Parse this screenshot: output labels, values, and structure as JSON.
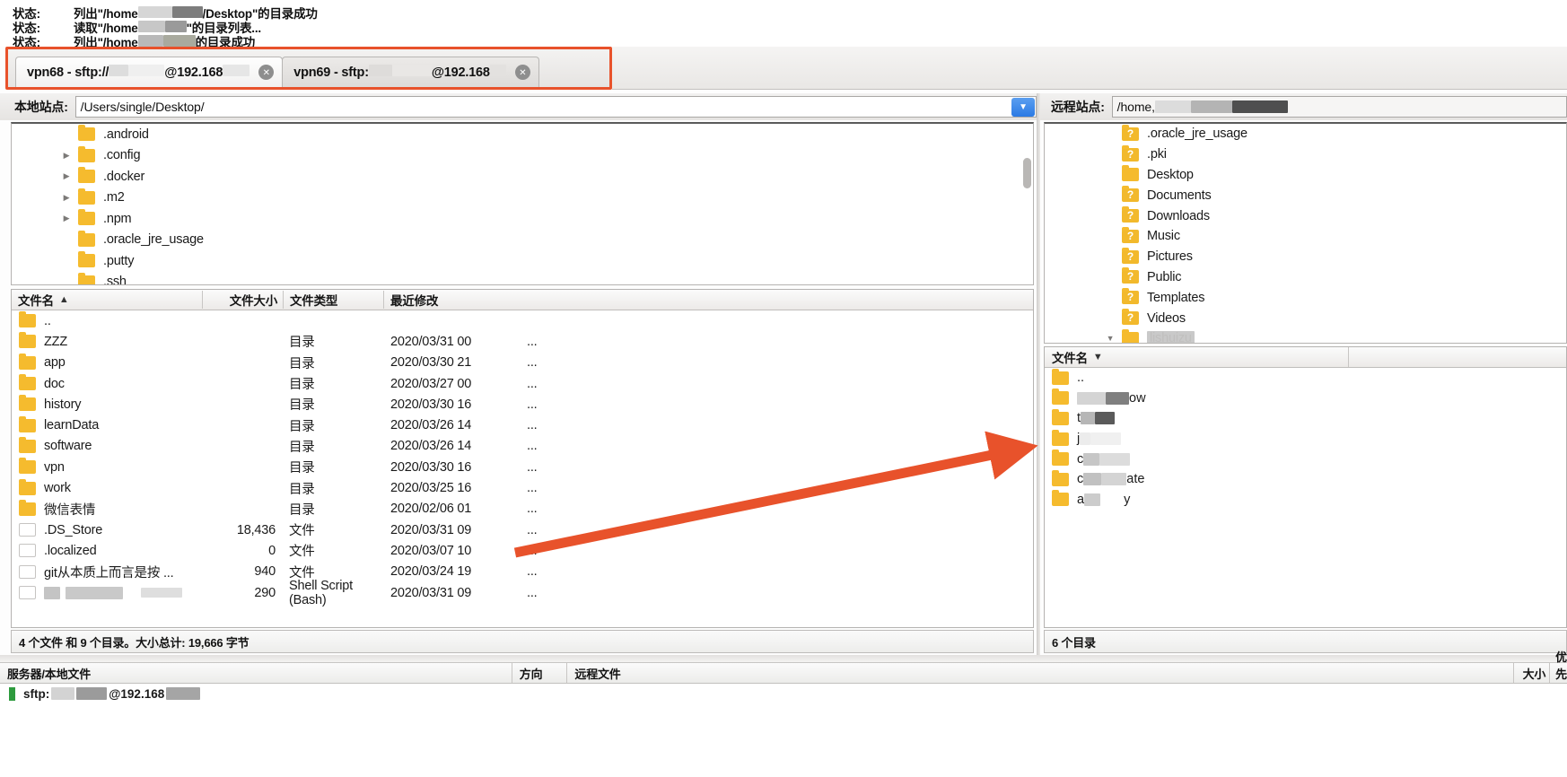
{
  "message_log": {
    "label": "状态:",
    "rows": [
      {
        "prefix": "列出\"/home",
        "suffix": "/Desktop\"的目录成功"
      },
      {
        "prefix": "读取\"/home",
        "suffix": "\"的目录列表..."
      },
      {
        "prefix": "列出\"/home",
        "suffix": "的目录成功"
      }
    ]
  },
  "tabs": {
    "highlighted": true,
    "highlight_color": "#e8522b",
    "items": [
      {
        "title_start": "vpn68 - sftp://",
        "title_mid": "@192.168",
        "title_end": "",
        "active": true,
        "close_label": "✕"
      },
      {
        "title_start": "vpn69 - sftp:",
        "title_mid": "@192.168",
        "title_end": "",
        "active": false,
        "close_label": "✕"
      }
    ]
  },
  "local": {
    "site_label": "本地站点:",
    "site_path": "/Users/single/Desktop/",
    "dropdown_icon": "chevron-down-icon",
    "tree": [
      {
        "name": ".android",
        "expandable": false
      },
      {
        "name": ".config",
        "expandable": true
      },
      {
        "name": ".docker",
        "expandable": true
      },
      {
        "name": ".m2",
        "expandable": true
      },
      {
        "name": ".npm",
        "expandable": true
      },
      {
        "name": ".oracle_jre_usage",
        "expandable": false
      },
      {
        "name": ".putty",
        "expandable": false
      },
      {
        "name": ".ssh",
        "expandable": false
      }
    ],
    "columns": [
      "文件名",
      "文件大小",
      "文件类型",
      "最近修改"
    ],
    "sort_indicator": "▲",
    "files": [
      {
        "name": "..",
        "size": "",
        "type": "",
        "modified": "",
        "ell": "",
        "icon": "folder"
      },
      {
        "name": "ZZZ",
        "size": "",
        "type": "目录",
        "modified": "2020/03/31 00",
        "ell": "...",
        "icon": "folder"
      },
      {
        "name": "app",
        "size": "",
        "type": "目录",
        "modified": "2020/03/30 21",
        "ell": "...",
        "icon": "folder"
      },
      {
        "name": "doc",
        "size": "",
        "type": "目录",
        "modified": "2020/03/27 00",
        "ell": "...",
        "icon": "folder"
      },
      {
        "name": "history",
        "size": "",
        "type": "目录",
        "modified": "2020/03/30 16",
        "ell": "...",
        "icon": "folder"
      },
      {
        "name": "learnData",
        "size": "",
        "type": "目录",
        "modified": "2020/03/26 14",
        "ell": "...",
        "icon": "folder"
      },
      {
        "name": "software",
        "size": "",
        "type": "目录",
        "modified": "2020/03/26 14",
        "ell": "...",
        "icon": "folder"
      },
      {
        "name": "vpn",
        "size": "",
        "type": "目录",
        "modified": "2020/03/30 16",
        "ell": "...",
        "icon": "folder"
      },
      {
        "name": "work",
        "size": "",
        "type": "目录",
        "modified": "2020/03/25 16",
        "ell": "...",
        "icon": "folder"
      },
      {
        "name": "微信表情",
        "size": "",
        "type": "目录",
        "modified": "2020/02/06 01",
        "ell": "...",
        "icon": "folder"
      },
      {
        "name": ".DS_Store",
        "size": "18,436",
        "type": "文件",
        "modified": "2020/03/31 09",
        "ell": "...",
        "icon": "file"
      },
      {
        "name": ".localized",
        "size": "0",
        "type": "文件",
        "modified": "2020/03/07 10",
        "ell": "...",
        "icon": "file"
      },
      {
        "name": "git从本质上而言是按 ...",
        "size": "940",
        "type": "文件",
        "modified": "2020/03/24 19",
        "ell": "...",
        "icon": "file"
      },
      {
        "name": "",
        "size": "290",
        "type": "Shell Script (Bash)",
        "modified": "2020/03/31 09",
        "ell": "...",
        "icon": "file",
        "redacted": true
      }
    ],
    "status": "4 个文件 和 9 个目录。大小总计: 19,666 字节"
  },
  "remote": {
    "site_label": "远程站点:",
    "site_path": "/home,",
    "tree": [
      {
        "name": ".oracle_jre_usage",
        "icon": "question-folder",
        "expandable": false,
        "selected": false
      },
      {
        "name": ".pki",
        "icon": "question-folder",
        "expandable": false,
        "selected": false
      },
      {
        "name": "Desktop",
        "icon": "folder",
        "expandable": false,
        "selected": false
      },
      {
        "name": "Documents",
        "icon": "question-folder",
        "expandable": false,
        "selected": false
      },
      {
        "name": "Downloads",
        "icon": "question-folder",
        "expandable": false,
        "selected": false
      },
      {
        "name": "Music",
        "icon": "question-folder",
        "expandable": false,
        "selected": false
      },
      {
        "name": "Pictures",
        "icon": "question-folder",
        "expandable": false,
        "selected": false
      },
      {
        "name": "Public",
        "icon": "question-folder",
        "expandable": false,
        "selected": false
      },
      {
        "name": "Templates",
        "icon": "question-folder",
        "expandable": false,
        "selected": false
      },
      {
        "name": "Videos",
        "icon": "question-folder",
        "expandable": false,
        "selected": false
      },
      {
        "name": "lishuizu",
        "icon": "folder",
        "expandable": true,
        "selected": true
      }
    ],
    "columns": [
      "文件名"
    ],
    "sort_indicator": "▼",
    "files": [
      {
        "name": "..",
        "redacted": false,
        "tail": ""
      },
      {
        "name": "",
        "redacted": true,
        "tail": "ow"
      },
      {
        "name": "t",
        "redacted": true,
        "tail": ""
      },
      {
        "name": "j",
        "redacted": true,
        "tail": ""
      },
      {
        "name": "c",
        "redacted": true,
        "tail": ""
      },
      {
        "name": "c",
        "redacted": true,
        "tail": "ate"
      },
      {
        "name": "a",
        "redacted": true,
        "tail": "y"
      }
    ],
    "status": "6 个目录"
  },
  "queue": {
    "columns": [
      "服务器/本地文件",
      "方向",
      "远程文件",
      "大小",
      "优先级"
    ],
    "rows": [
      {
        "server": "sftp:",
        "server_tail": "@192.168",
        "status_color": "#2e9b3e"
      }
    ]
  },
  "annotation": {
    "arrow_color": "#e8522b",
    "arrow_name": "drag-direction-arrow"
  }
}
